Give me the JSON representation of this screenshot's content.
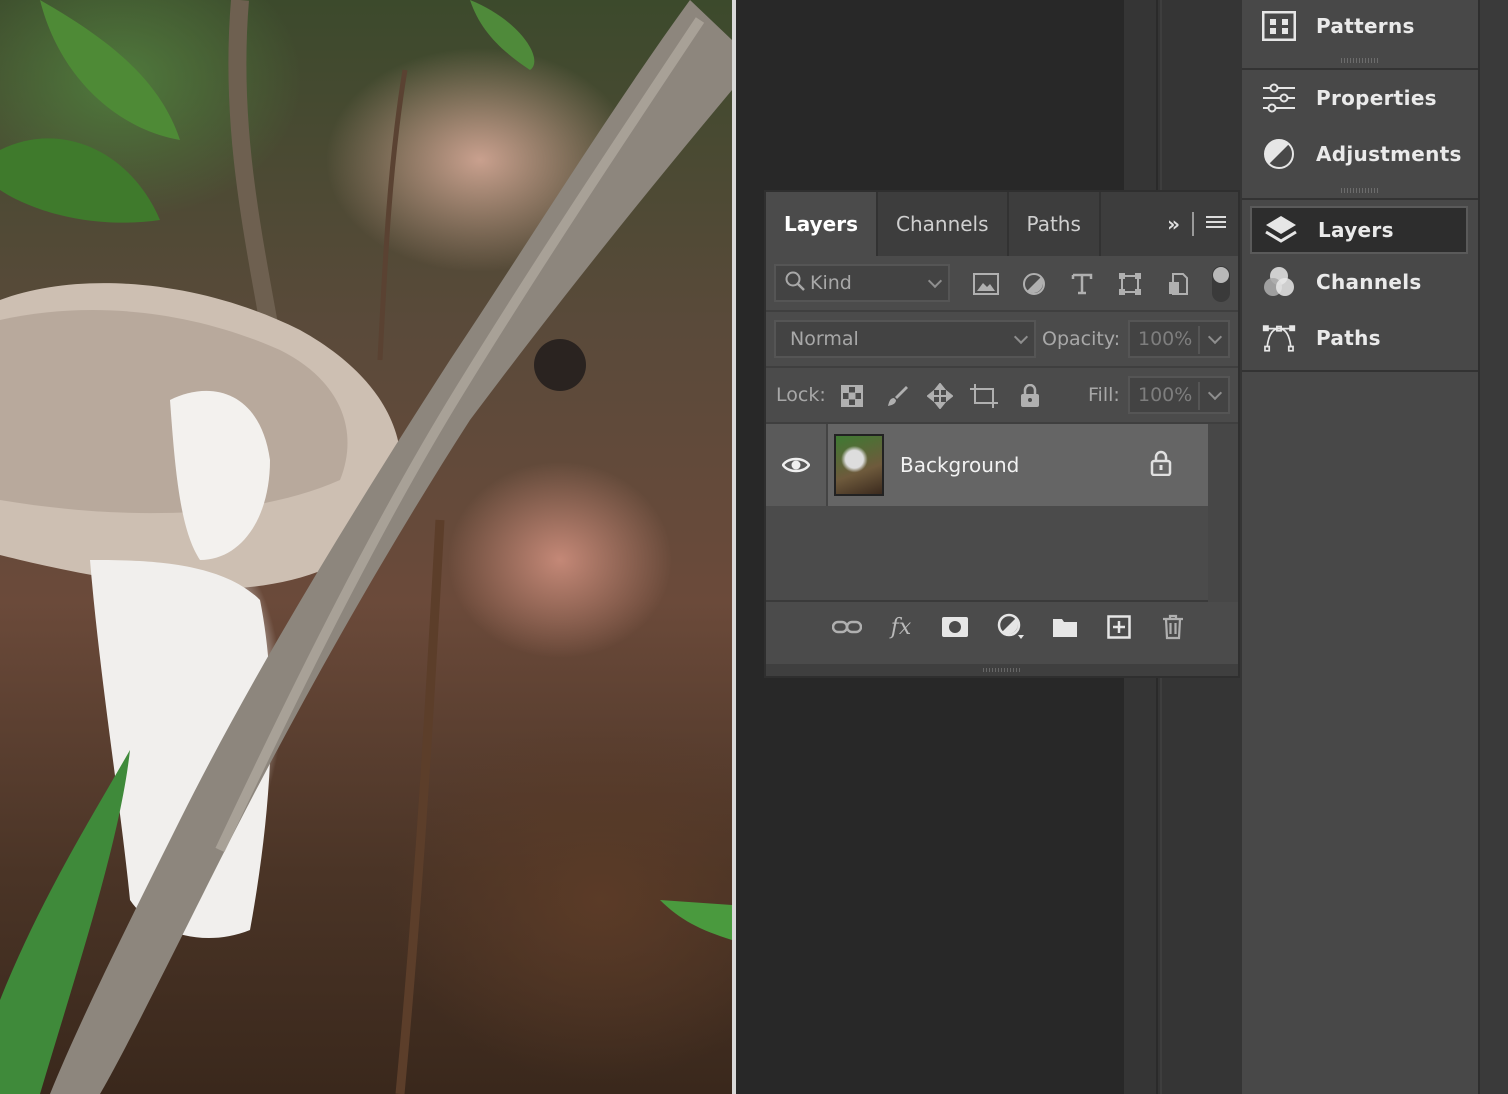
{
  "dock": {
    "patterns_label": "Patterns",
    "properties_label": "Properties",
    "adjustments_label": "Adjustments",
    "layers_label": "Layers",
    "channels_label": "Channels",
    "paths_label": "Paths"
  },
  "layers_panel": {
    "tabs": [
      {
        "label": "Layers",
        "active": true
      },
      {
        "label": "Channels",
        "active": false
      },
      {
        "label": "Paths",
        "active": false
      }
    ],
    "filter": {
      "kind_label": "Kind"
    },
    "blend_mode": "Normal",
    "opacity_label": "Opacity:",
    "opacity_value": "100%",
    "lock_label": "Lock:",
    "fill_label": "Fill:",
    "fill_value": "100%",
    "layers": [
      {
        "name": "Background",
        "visible": true,
        "locked": true
      }
    ],
    "footer": {
      "fx_label": "fx"
    }
  },
  "canvas": {
    "content": "forest mushroom photo"
  },
  "colors": {
    "panel_bg": "#4b4b4b",
    "dock_bg": "#484848",
    "workspace_bg": "#282828",
    "selected_layer": "#656565"
  }
}
